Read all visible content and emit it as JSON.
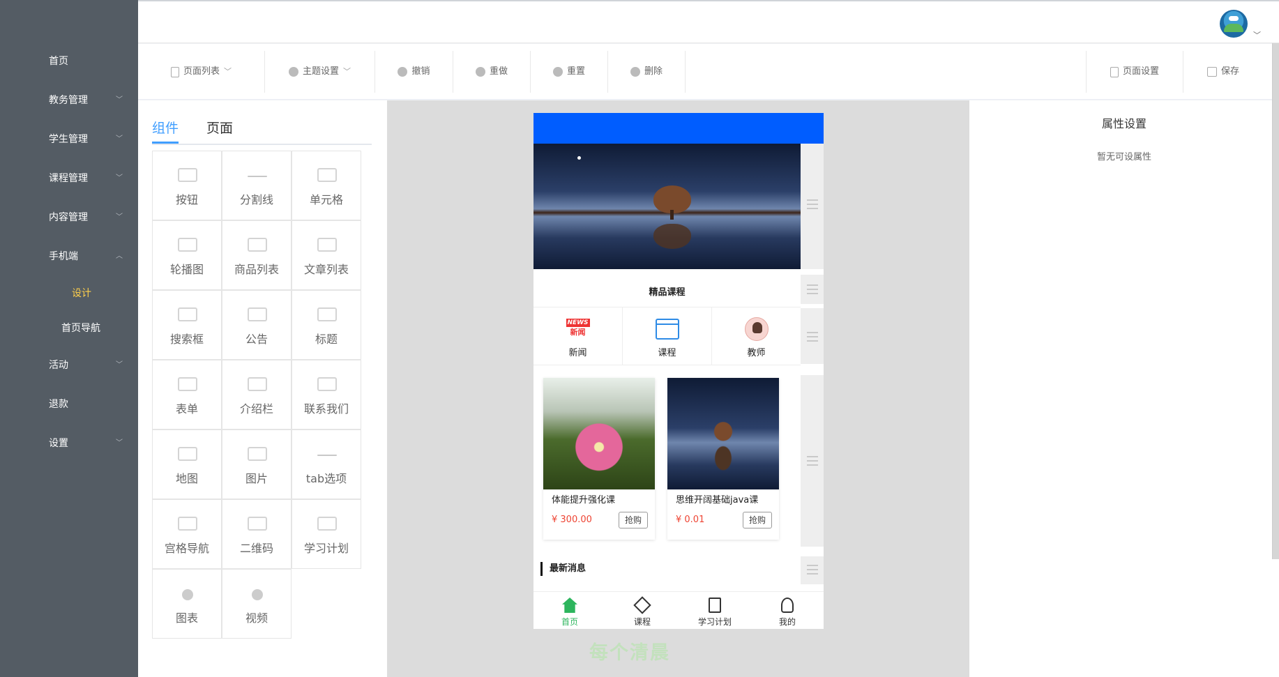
{
  "sidebar": {
    "items": [
      {
        "label": "首页",
        "has_arrow": false
      },
      {
        "label": "教务管理",
        "has_arrow": true
      },
      {
        "label": "学生管理",
        "has_arrow": true
      },
      {
        "label": "课程管理",
        "has_arrow": true
      },
      {
        "label": "内容管理",
        "has_arrow": true
      },
      {
        "label": "手机端",
        "has_arrow": true,
        "expanded": true
      }
    ],
    "sub_items": [
      {
        "label": "设计",
        "active": true
      },
      {
        "label": "首页导航",
        "active": false
      }
    ],
    "items_after": [
      {
        "label": "活动",
        "has_arrow": true
      },
      {
        "label": "退款",
        "has_arrow": false
      },
      {
        "label": "设置",
        "has_arrow": true
      }
    ],
    "active_color": "#ffd04b",
    "bg_color": "#545c64"
  },
  "toolbar": {
    "page_list": "页面列表",
    "theme": "主题设置",
    "undo": "撤销",
    "redo": "重做",
    "reset": "重置",
    "delete": "删除",
    "page_settings": "页面设置",
    "save": "保存"
  },
  "component_panel": {
    "tabs": [
      "组件",
      "页面"
    ],
    "components": [
      "按钮",
      "分割线",
      "单元格",
      "轮播图",
      "商品列表",
      "文章列表",
      "搜索框",
      "公告",
      "标题",
      "表单",
      "介绍栏",
      "联系我们",
      "地图",
      "图片",
      "tab选项",
      "宫格导航",
      "二维码",
      "学习计划",
      "图表",
      "视频"
    ]
  },
  "phone": {
    "header_color": "#005dff",
    "section_title": "精品课程",
    "nav": [
      {
        "label": "新闻",
        "icon": "news-icon"
      },
      {
        "label": "课程",
        "icon": "calendar-icon"
      },
      {
        "label": "教师",
        "icon": "teacher-avatar-icon"
      }
    ],
    "news_badge": "NEWS",
    "news_text": "新闻",
    "goods": [
      {
        "name": "体能提升强化课",
        "price": "¥ 300.00",
        "buy": "抢购"
      },
      {
        "name": "思维开阔基础java课",
        "price": "¥ 0.01",
        "buy": "抢购"
      }
    ],
    "latest_news": "最新消息",
    "tabbar": [
      {
        "label": "首页",
        "icon": "home-icon",
        "active": true
      },
      {
        "label": "课程",
        "icon": "tools-icon",
        "active": false
      },
      {
        "label": "学习计划",
        "icon": "plan-icon",
        "active": false
      },
      {
        "label": "我的",
        "icon": "user-icon",
        "active": false
      }
    ]
  },
  "watermark": "每个清晨",
  "properties": {
    "title": "属性设置",
    "empty": "暂无可设属性"
  }
}
